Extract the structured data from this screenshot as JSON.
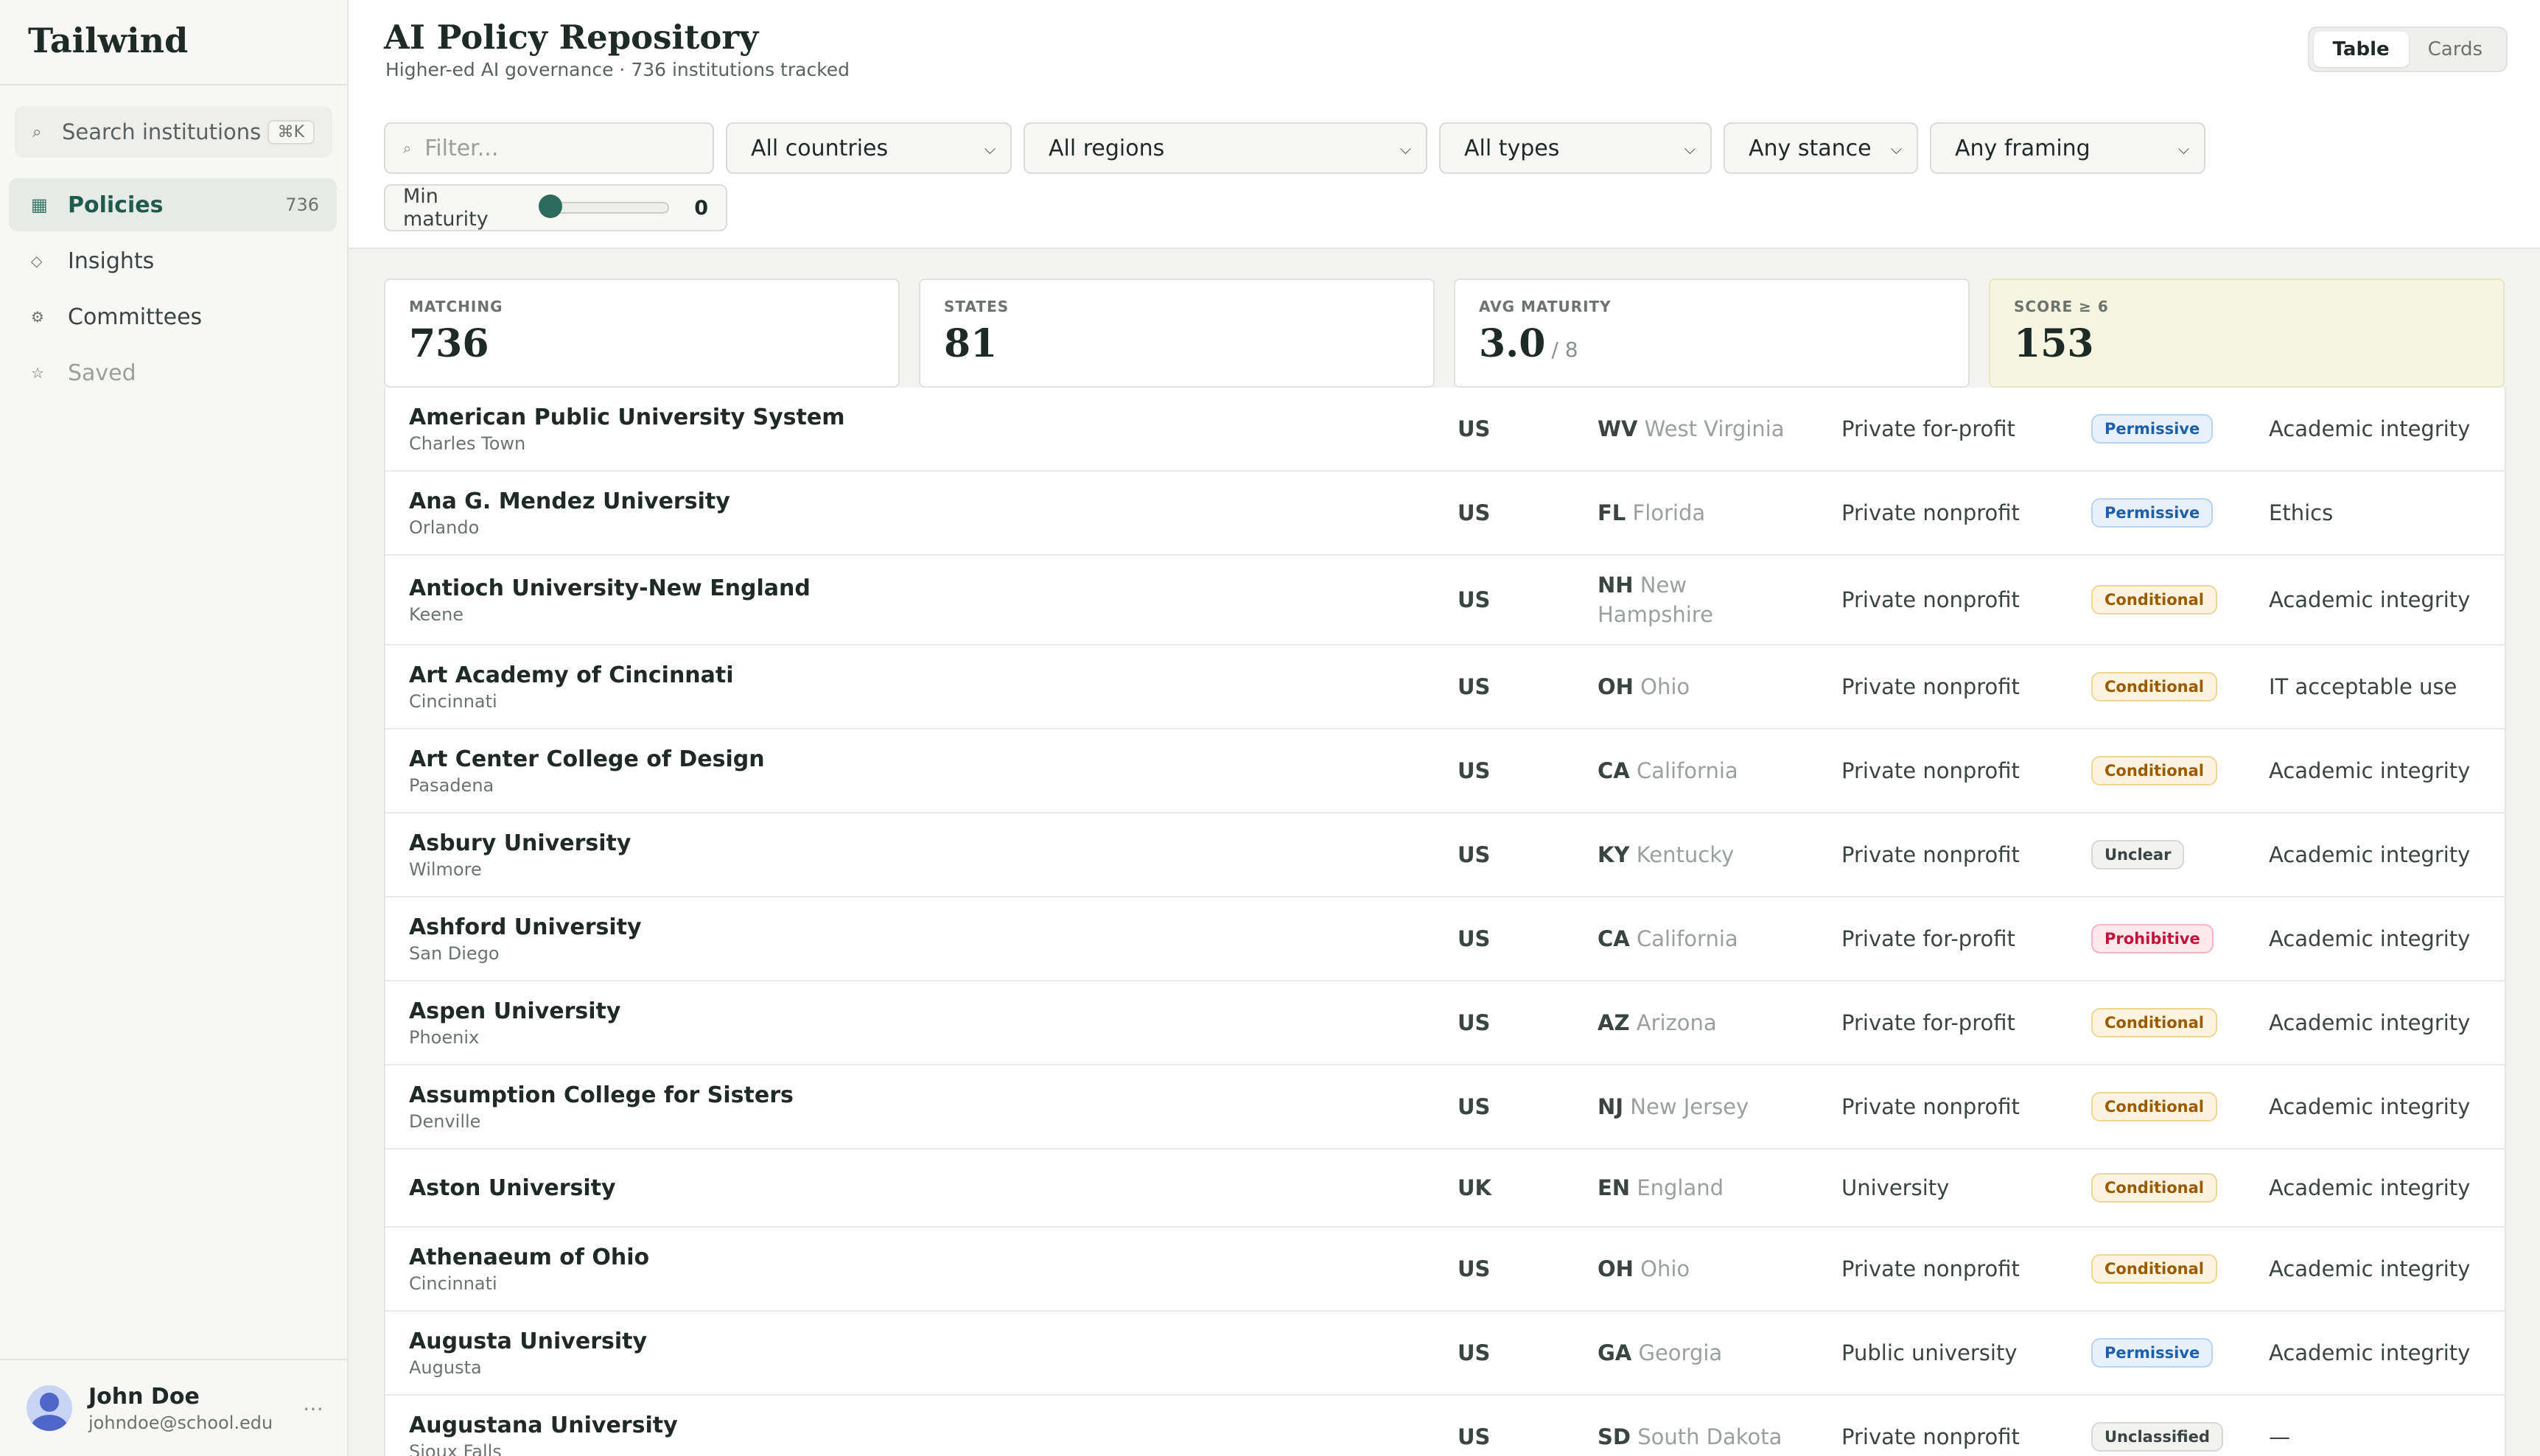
{
  "sidebar": {
    "brand": "Tailwind",
    "search": {
      "label": "Search institutions",
      "shortcut": "⌘K"
    },
    "items": [
      {
        "label": "Policies",
        "count": "736",
        "icon": "table-icon"
      },
      {
        "label": "Insights",
        "count": "",
        "icon": "diamond-icon"
      },
      {
        "label": "Committees",
        "count": "",
        "icon": "gear-icon"
      },
      {
        "label": "Saved",
        "count": "",
        "icon": "star-icon"
      }
    ],
    "user": {
      "name": "John Doe",
      "email": "johndoe@school.edu",
      "more": "⋯"
    }
  },
  "header": {
    "title": "AI Policy Repository",
    "subtitle": "Higher-ed AI governance · 736 institutions tracked",
    "view_toggle": [
      "Table",
      "Cards"
    ],
    "active_view": "Table"
  },
  "filters": {
    "filter_placeholder": "Filter...",
    "country": "All countries",
    "region": "All regions",
    "type": "All types",
    "stance": "Any stance",
    "framing": "Any framing",
    "maturity_label": "Min maturity",
    "maturity_value": "0"
  },
  "stats": {
    "matching": {
      "label": "MATCHING",
      "value": "736"
    },
    "states": {
      "label": "STATES",
      "value": "81"
    },
    "avg_maturity": {
      "label": "AVG MATURITY",
      "value": "3.0",
      "suffix": "/ 8"
    },
    "score": {
      "label": "SCORE ≥ 6",
      "value": "153"
    }
  },
  "stance_colors": {
    "Permissive": "#1d5fa8",
    "Conditional": "#9a5a00",
    "Unclear": "#3a4440",
    "Prohibitive": "#c0143c",
    "Unclassified": "#3a4440"
  },
  "rows": [
    {
      "name": "American Public University System",
      "city": "Charles Town",
      "country": "US",
      "code": "WV",
      "state": "West Virginia",
      "type": "Private for-profit",
      "stance": "Permissive",
      "framing": "Academic integrity"
    },
    {
      "name": "Ana G. Mendez University",
      "city": "Orlando",
      "country": "US",
      "code": "FL",
      "state": "Florida",
      "type": "Private nonprofit",
      "stance": "Permissive",
      "framing": "Ethics"
    },
    {
      "name": "Antioch University-New England",
      "city": "Keene",
      "country": "US",
      "code": "NH",
      "state": "New Hampshire",
      "type": "Private nonprofit",
      "stance": "Conditional",
      "framing": "Academic integrity"
    },
    {
      "name": "Art Academy of Cincinnati",
      "city": "Cincinnati",
      "country": "US",
      "code": "OH",
      "state": "Ohio",
      "type": "Private nonprofit",
      "stance": "Conditional",
      "framing": "IT acceptable use"
    },
    {
      "name": "Art Center College of Design",
      "city": "Pasadena",
      "country": "US",
      "code": "CA",
      "state": "California",
      "type": "Private nonprofit",
      "stance": "Conditional",
      "framing": "Academic integrity"
    },
    {
      "name": "Asbury University",
      "city": "Wilmore",
      "country": "US",
      "code": "KY",
      "state": "Kentucky",
      "type": "Private nonprofit",
      "stance": "Unclear",
      "framing": "Academic integrity"
    },
    {
      "name": "Ashford University",
      "city": "San Diego",
      "country": "US",
      "code": "CA",
      "state": "California",
      "type": "Private for-profit",
      "stance": "Prohibitive",
      "framing": "Academic integrity"
    },
    {
      "name": "Aspen University",
      "city": "Phoenix",
      "country": "US",
      "code": "AZ",
      "state": "Arizona",
      "type": "Private for-profit",
      "stance": "Conditional",
      "framing": "Academic integrity"
    },
    {
      "name": "Assumption College for Sisters",
      "city": "Denville",
      "country": "US",
      "code": "NJ",
      "state": "New Jersey",
      "type": "Private nonprofit",
      "stance": "Conditional",
      "framing": "Academic integrity"
    },
    {
      "name": "Aston University",
      "city": "",
      "country": "UK",
      "code": "EN",
      "state": "England",
      "type": "University",
      "stance": "Conditional",
      "framing": "Academic integrity"
    },
    {
      "name": "Athenaeum of Ohio",
      "city": "Cincinnati",
      "country": "US",
      "code": "OH",
      "state": "Ohio",
      "type": "Private nonprofit",
      "stance": "Conditional",
      "framing": "Academic integrity"
    },
    {
      "name": "Augusta University",
      "city": "Augusta",
      "country": "US",
      "code": "GA",
      "state": "Georgia",
      "type": "Public university",
      "stance": "Permissive",
      "framing": "Academic integrity"
    },
    {
      "name": "Augustana University",
      "city": "Sioux Falls",
      "country": "US",
      "code": "SD",
      "state": "South Dakota",
      "type": "Private nonprofit",
      "stance": "Unclassified",
      "framing": "—"
    }
  ]
}
